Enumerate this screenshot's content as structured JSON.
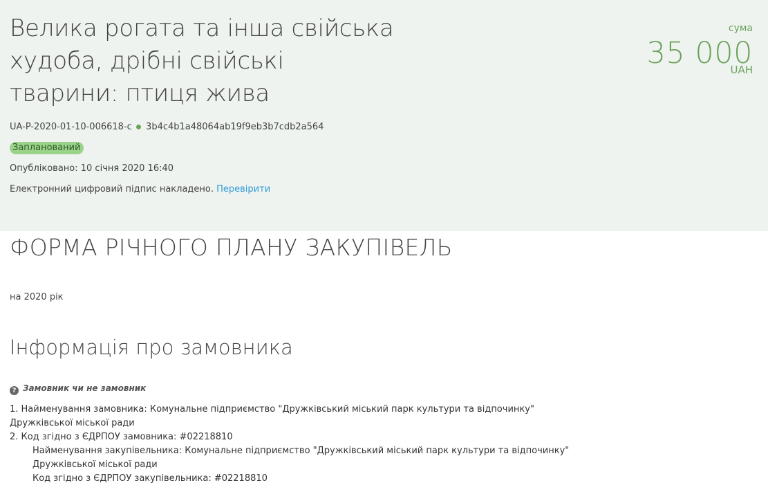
{
  "header": {
    "title": "Велика рогата та інша свійська худоба, дрібні свійські тварини: птиця жива",
    "sum_label": "сума",
    "sum_value": "35 000",
    "sum_currency": "UAH",
    "plan_id": "UA-P-2020-01-10-006618-c",
    "hash": "3b4c4b1a48064ab19f9eb3b7cdb2a564",
    "status": "Запланований",
    "published": "Опубліковано: 10 січня 2020 16:40",
    "signature_text": "Електронний цифровий підпис накладено.",
    "verify_link": "Перевірити"
  },
  "form": {
    "title": "ФОРМА РІЧНОГО ПЛАНУ ЗАКУПІВЕЛЬ",
    "year": "на 2020 рік"
  },
  "customer": {
    "section_title": "Інформація про замовника",
    "hint": "Замовник чи не замовник",
    "line1": "1. Найменування замовника: Комунальне підприємство \"Дружківський міський парк культури та відпочинку\"",
    "line1_cont": "Дружківської міської ради",
    "line2": "2. Код згідно з ЄДРПОУ замовника: #02218810",
    "buyer_name": "Найменування закупівельника: Комунальне підприємство \"Дружківський міський парк культури та відпочинку\"",
    "buyer_name_cont": "Дружківської міської ради",
    "buyer_code": "Код згідно з ЄДРПОУ закупівельника: #02218810"
  },
  "colors": {
    "header_bg": "#eef3ef",
    "accent_green": "#6aa35a",
    "badge_bg": "#9ad38a",
    "link_blue": "#2f9bd6"
  },
  "icons": {
    "hint": "question-circle-icon",
    "status_dot": "green-dot-icon"
  }
}
